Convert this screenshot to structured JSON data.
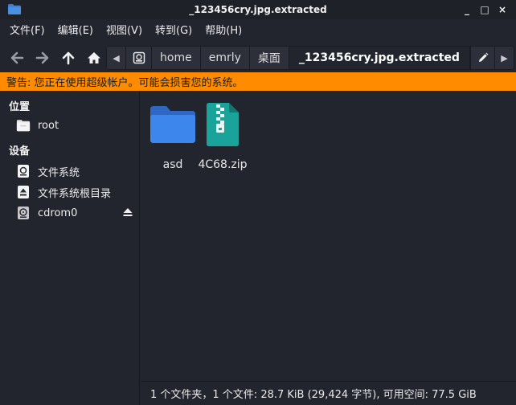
{
  "window": {
    "title": "_123456cry.jpg.extracted",
    "controls": {
      "minimize": "_",
      "maximize": "□",
      "close": "×"
    }
  },
  "menu": [
    {
      "label": "文件(F)"
    },
    {
      "label": "编辑(E)"
    },
    {
      "label": "视图(V)"
    },
    {
      "label": "转到(G)"
    },
    {
      "label": "帮助(H)"
    }
  ],
  "toolbar": {
    "back_icon": "arrow-left-icon",
    "forward_icon": "arrow-right-icon",
    "up_icon": "arrow-up-icon",
    "home_icon": "home-icon"
  },
  "pathbar": {
    "scroll_left": "◀",
    "scroll_right": "▶",
    "crumbs": [
      {
        "label": "home"
      },
      {
        "label": "emrly"
      },
      {
        "label": "桌面"
      },
      {
        "label": "_123456cry.jpg.extracted",
        "active": true
      }
    ]
  },
  "warning": {
    "text": "警告: 您正在使用超级帐户。可能会损害您的系统。",
    "color": "#ff8c00"
  },
  "sidebar": {
    "places_heading": "位置",
    "places": [
      {
        "label": "root",
        "icon": "folder-home-icon"
      }
    ],
    "devices_heading": "设备",
    "devices": [
      {
        "label": "文件系统",
        "icon": "drive-icon"
      },
      {
        "label": "文件系统根目录",
        "icon": "drive-root-icon"
      },
      {
        "label": "cdrom0",
        "icon": "optical-drive-icon",
        "eject": true
      }
    ]
  },
  "files": [
    {
      "name": "asd",
      "type": "folder",
      "icon": "folder-icon"
    },
    {
      "name": "4C68.zip",
      "type": "zip",
      "icon": "zip-archive-icon"
    }
  ],
  "status": {
    "text": "1 个文件夹，1 个文件: 28.7 KiB (29,424 字节), 可用空间: 77.5 GiB"
  },
  "colors": {
    "accent": "#3b82f6",
    "folder": "#3a7bd5",
    "zip": "#1aa39a",
    "warning": "#ff8c00"
  }
}
